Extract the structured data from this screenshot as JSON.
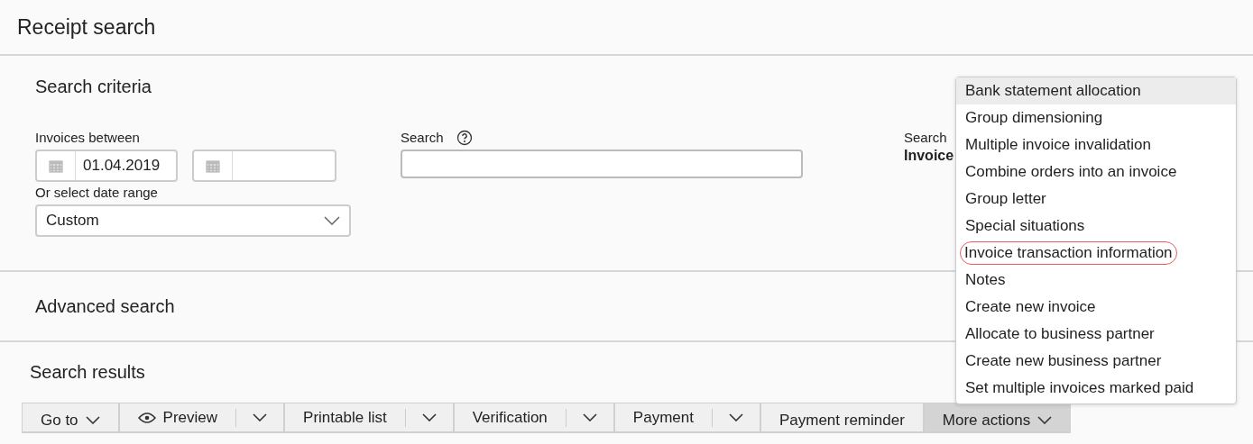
{
  "page": {
    "title": "Receipt search"
  },
  "criteria": {
    "heading": "Search criteria",
    "date_label": "Invoices between",
    "date_from": "01.04.2019",
    "range_label": "Or select date range",
    "range_value": "Custom",
    "search_label": "Search",
    "search_target_label": "Search",
    "search_target_value": "Invoice"
  },
  "advanced": {
    "heading": "Advanced search"
  },
  "results": {
    "heading": "Search results"
  },
  "toolbar": [
    {
      "kind": "dropdown",
      "label": "Go to",
      "active": false
    },
    {
      "kind": "preview",
      "label": "Preview",
      "active": false
    },
    {
      "kind": "split",
      "label": "Printable list",
      "active": false
    },
    {
      "kind": "split",
      "label": "Verification",
      "active": false
    },
    {
      "kind": "split",
      "label": "Payment",
      "active": false
    },
    {
      "kind": "plain",
      "label": "Payment reminder",
      "active": false
    },
    {
      "kind": "dropdown",
      "label": "More actions",
      "active": true
    }
  ],
  "menu": [
    {
      "label": "Bank statement allocation",
      "selected": true,
      "circled": false
    },
    {
      "label": "Group dimensioning",
      "selected": false,
      "circled": false
    },
    {
      "label": "Multiple invoice invalidation",
      "selected": false,
      "circled": false
    },
    {
      "label": "Combine orders into an invoice",
      "selected": false,
      "circled": false
    },
    {
      "label": "Group letter",
      "selected": false,
      "circled": false
    },
    {
      "label": "Special situations",
      "selected": false,
      "circled": false
    },
    {
      "label": "Invoice transaction information",
      "selected": false,
      "circled": true
    },
    {
      "label": "Notes",
      "selected": false,
      "circled": false
    },
    {
      "label": "Create new invoice",
      "selected": false,
      "circled": false
    },
    {
      "label": "Allocate to business partner",
      "selected": false,
      "circled": false
    },
    {
      "label": "Create new business partner",
      "selected": false,
      "circled": false
    },
    {
      "label": "Set multiple invoices marked paid",
      "selected": false,
      "circled": false
    }
  ]
}
